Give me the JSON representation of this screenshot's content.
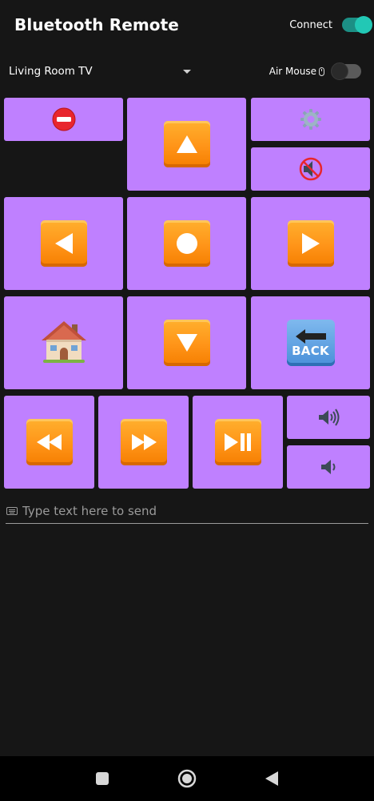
{
  "app": {
    "title": "Bluetooth Remote",
    "connect_label": "Connect",
    "connected": true
  },
  "device": {
    "selected": "Living Room TV",
    "air_mouse_label": "Air Mouse",
    "air_mouse_on": false
  },
  "buttons": [
    {
      "name": "power-button",
      "icon": "no-entry-icon"
    },
    {
      "name": "dpad-up-button",
      "icon": "up-arrow-icon"
    },
    {
      "name": "settings-button",
      "icon": "gear-icon"
    },
    {
      "name": "mute-button",
      "icon": "muted-speaker-icon"
    },
    {
      "name": "dpad-left-button",
      "icon": "left-arrow-icon"
    },
    {
      "name": "dpad-center-button",
      "icon": "record-circle-icon"
    },
    {
      "name": "dpad-right-button",
      "icon": "right-arrow-icon"
    },
    {
      "name": "home-button",
      "icon": "house-icon"
    },
    {
      "name": "dpad-down-button",
      "icon": "down-arrow-icon"
    },
    {
      "name": "back-button",
      "icon": "back-arrow-icon"
    },
    {
      "name": "rewind-button",
      "icon": "rewind-icon"
    },
    {
      "name": "fast-forward-button",
      "icon": "fast-forward-icon"
    },
    {
      "name": "play-pause-button",
      "icon": "play-pause-icon"
    },
    {
      "name": "volume-up-button",
      "icon": "loud-speaker-icon"
    },
    {
      "name": "volume-down-button",
      "icon": "quiet-speaker-icon"
    }
  ],
  "back_tile_text": "BACK",
  "text_input": {
    "placeholder": "Type text here to send",
    "value": ""
  },
  "nav": [
    "recents",
    "home",
    "back"
  ],
  "colors": {
    "background": "#161616",
    "button": "#bf80ff",
    "tile": "#ff9418",
    "switch_on": "#22c8b5"
  }
}
